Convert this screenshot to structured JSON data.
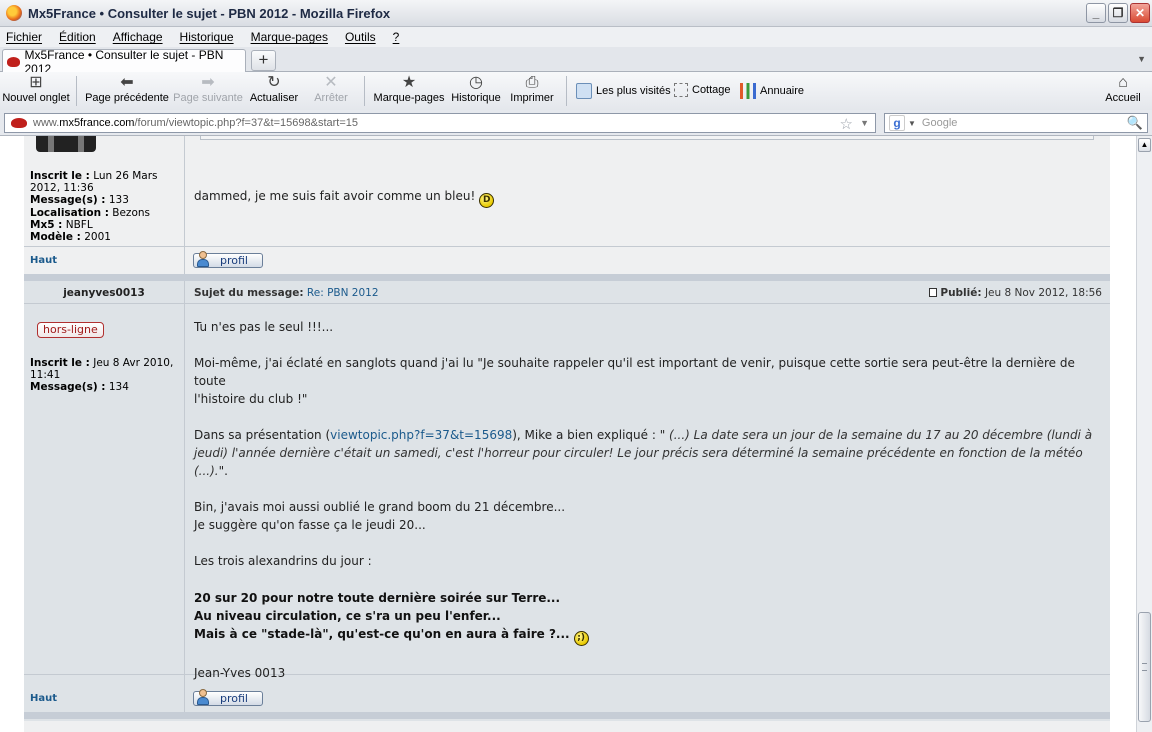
{
  "window": {
    "title": "Mx5France • Consulter le sujet - PBN 2012 - Mozilla Firefox",
    "minimize": "_",
    "maximize": "❐",
    "close": "✕"
  },
  "menu": [
    "Fichier",
    "Édition",
    "Affichage",
    "Historique",
    "Marque-pages",
    "Outils",
    "?"
  ],
  "tab": {
    "label": "Mx5France • Consulter le sujet - PBN 2012",
    "close": "×",
    "new": "+"
  },
  "toolbar": {
    "new_tab": "Nouvel onglet",
    "back": "Page précédente",
    "forward": "Page suivante",
    "reload": "Actualiser",
    "stop": "Arrêter",
    "bookmarks": "Marque-pages",
    "history": "Historique",
    "print": "Imprimer",
    "home": "Accueil"
  },
  "bookmarks_bar": [
    "Les plus visités",
    "Cottage",
    "Annuaire"
  ],
  "address": {
    "host_prefix": "www.",
    "host": "mx5france.com",
    "path": "/forum/viewtopic.php?f=37&t=15698&start=15"
  },
  "search": {
    "placeholder": "Google",
    "engine_letter": "g"
  },
  "post1": {
    "profile": {
      "joined_label": "Inscrit le :",
      "joined_value": "Lun 26 Mars 2012, 11:36",
      "messages_label": "Message(s) :",
      "messages_value": "133",
      "location_label": "Localisation :",
      "location_value": "Bezons",
      "mx5_label": "Mx5 :",
      "mx5_value": "NBFL",
      "model_label": "Modèle :",
      "model_value": "2001"
    },
    "body": "dammed, je me suis fait avoir comme un bleu!",
    "top_link": "Haut",
    "profile_button": "profil"
  },
  "post2": {
    "author": "jeanyves0013",
    "subject_label": "Sujet du message:",
    "subject_value": "Re: PBN 2012",
    "published_label": "Publié:",
    "published_value": "Jeu 8 Nov 2012, 18:56",
    "status": "hors-ligne",
    "profile": {
      "joined_label": "Inscrit le :",
      "joined_value": "Jeu 8 Avr 2010, 11:41",
      "messages_label": "Message(s) :",
      "messages_value": "134"
    },
    "p1": "Tu n'es pas le seul !!!...",
    "p2_line1": "Moi-même, j'ai éclaté en sanglots quand j'ai lu \"Je souhaite rappeler qu'il est important de venir, puisque cette sortie sera peut-être la dernière de toute",
    "p2_line2": "l'histoire du club !\"",
    "p3_prefix": "Dans sa présentation (",
    "p3_link": "viewtopic.php?f=37&t=15698",
    "p3_middle": "), Mike a bien expliqué : \"",
    "p3_italic1": " (...) La date sera un jour de la semaine du 17 au 20 décembre (lundi à",
    "p3_italic2": "jeudi) l'année dernière c'était un samedi, c'est l'horreur pour circuler! Le jour précis sera déterminé la semaine précédente en fonction de la météo (...).",
    "p3_end": "\".",
    "p4_line1": "Bin, j'avais moi aussi oublié le grand boom du 21 décembre...",
    "p4_line2": "Je suggère qu'on fasse ça le jeudi 20...",
    "p5": "Les trois alexandrins du jour :",
    "verse1": "20 sur 20 pour notre toute dernière soirée sur Terre...",
    "verse2": "Au niveau circulation, ce s'ra un peu l'enfer...",
    "verse3": "Mais à ce \"stade-là\", qu'est-ce qu'on en aura à faire ?...",
    "signature": "Jean-Yves 0013",
    "top_link": "Haut",
    "profile_button": "profil"
  }
}
